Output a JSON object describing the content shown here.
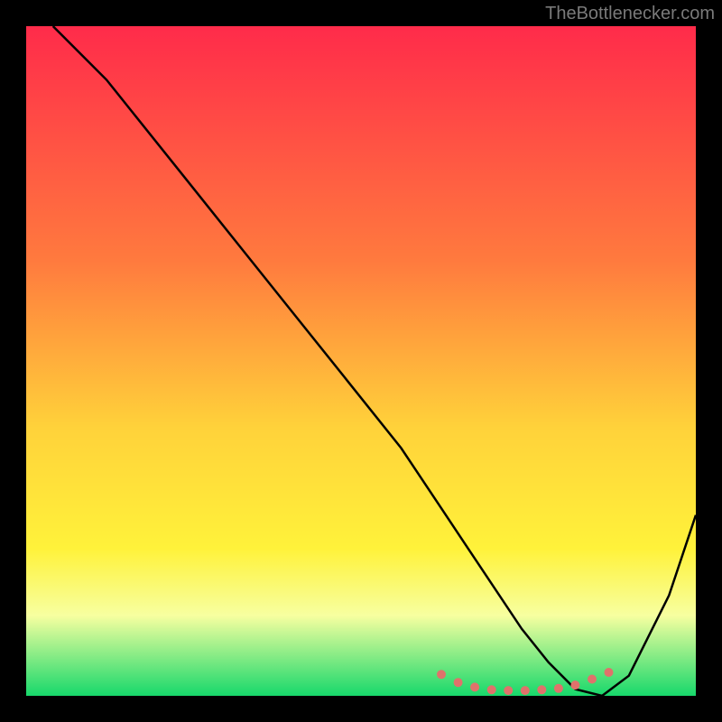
{
  "attribution": "TheBottlenecker.com",
  "chart_data": {
    "type": "line",
    "title": "",
    "xlabel": "",
    "ylabel": "",
    "xlim": [
      0,
      100
    ],
    "ylim": [
      0,
      100
    ],
    "gradient_stops": [
      {
        "offset": 0,
        "color": "#ff2b4a"
      },
      {
        "offset": 35,
        "color": "#ff7a3e"
      },
      {
        "offset": 60,
        "color": "#ffd23a"
      },
      {
        "offset": 78,
        "color": "#fff23a"
      },
      {
        "offset": 88,
        "color": "#f7ffa0"
      },
      {
        "offset": 100,
        "color": "#17d86b"
      }
    ],
    "series": [
      {
        "name": "bottleneck-curve",
        "color": "#000000",
        "x": [
          4,
          8,
          12,
          16,
          24,
          32,
          40,
          48,
          56,
          62,
          66,
          70,
          74,
          78,
          82,
          86,
          90,
          96,
          100
        ],
        "y": [
          100,
          96,
          92,
          87,
          77,
          67,
          57,
          47,
          37,
          28,
          22,
          16,
          10,
          5,
          1,
          0,
          3,
          15,
          27
        ]
      },
      {
        "name": "optimum-band",
        "color": "#e0726b",
        "type": "markers",
        "x": [
          62,
          64.5,
          67,
          69.5,
          72,
          74.5,
          77,
          79.5,
          82,
          84.5,
          87
        ],
        "y": [
          3.2,
          2.0,
          1.3,
          0.9,
          0.8,
          0.8,
          0.9,
          1.1,
          1.6,
          2.5,
          3.5
        ]
      }
    ]
  }
}
